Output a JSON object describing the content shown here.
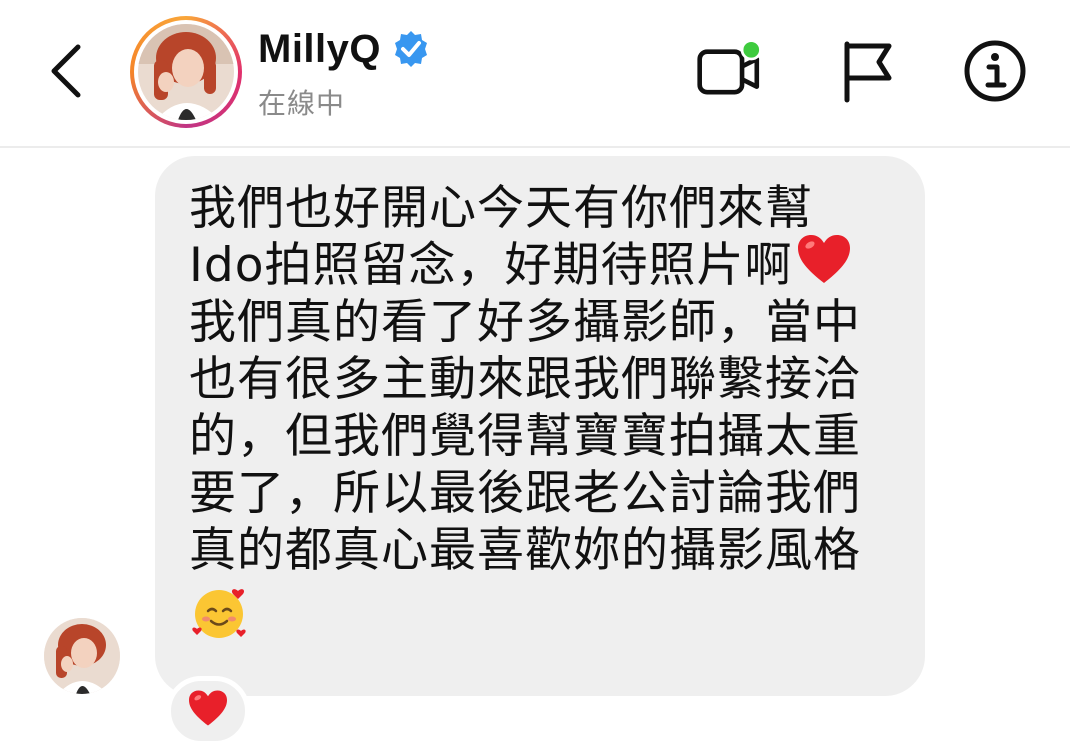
{
  "header": {
    "username": "MillyQ",
    "status": "在線中",
    "icons": {
      "back": "chevron-left-icon",
      "verified": "verified-badge-icon",
      "video": "video-call-icon",
      "flag": "flag-icon",
      "info": "info-icon"
    },
    "colors": {
      "verified": "#3897f0",
      "online_dot": "#3ecb3e"
    }
  },
  "message": {
    "lines": [
      "我們也好開心今天有你們來幫",
      "Ido拍照留念，好期待照片啊",
      "我們真的看了好多攝影師，當中",
      "也有很多主動來跟我們聯繫接洽",
      "的，但我們覺得幫寶寶拍攝太重",
      "要了，所以最後跟老公討論我們",
      "真的都真心最喜歡妳的攝影風格"
    ],
    "inline_emoji": "red-heart-icon",
    "trailing_emoji": "smiling-face-with-hearts-icon",
    "bubble_color": "#efefef"
  },
  "reaction": {
    "emoji": "red-heart-icon"
  }
}
